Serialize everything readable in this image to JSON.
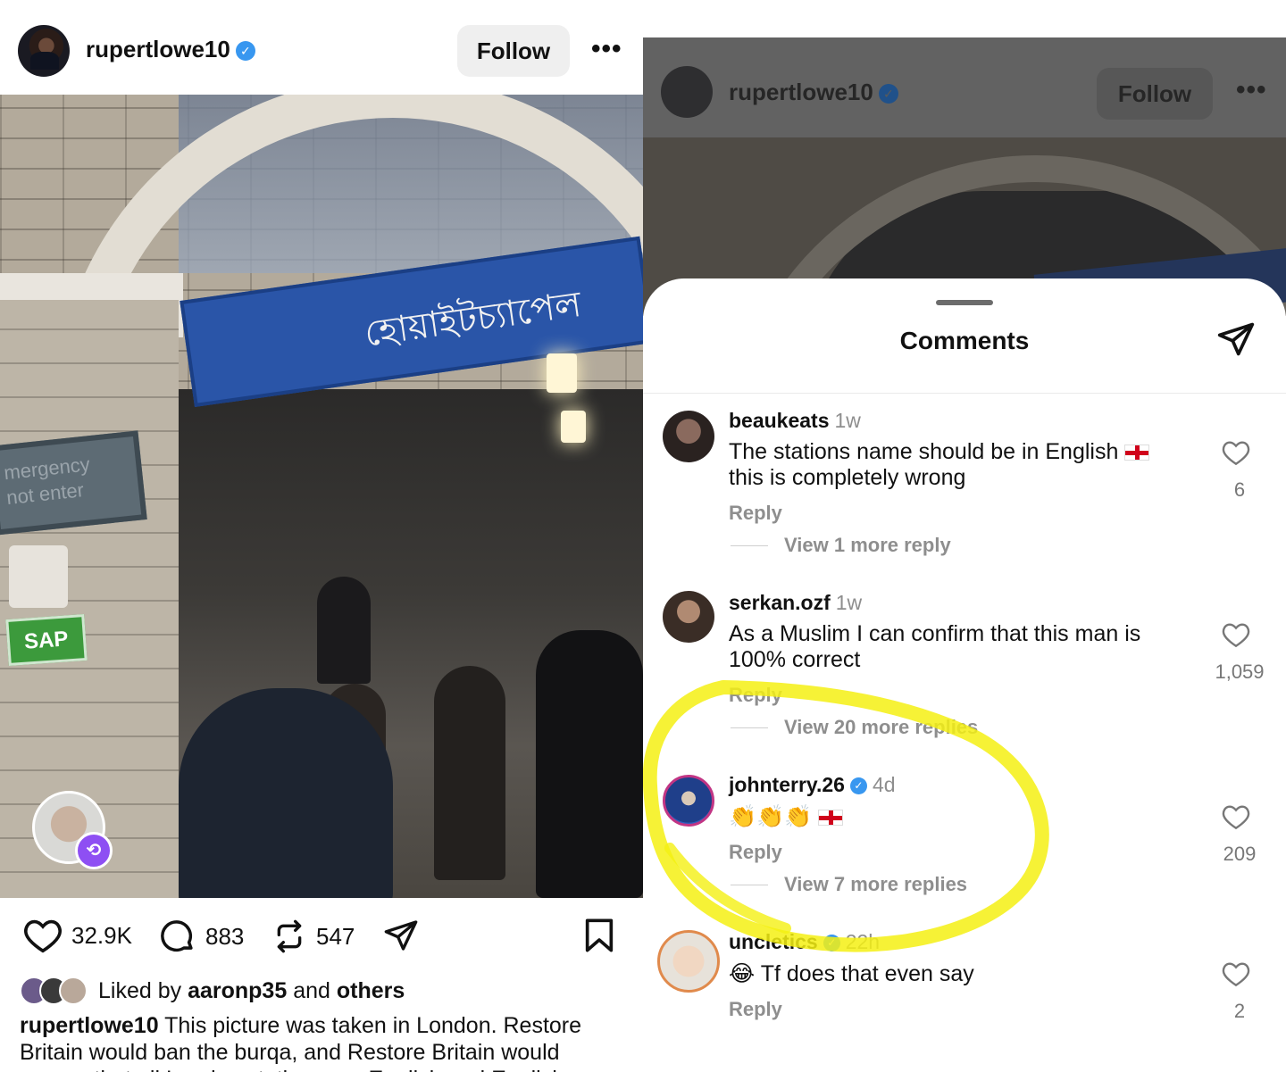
{
  "left_post": {
    "username": "rupertlowe10",
    "follow_label": "Follow",
    "more_label": "•••",
    "photo_sign_text": "হোয়াইটচ্যাপেল",
    "emergency_sign_text": "mergency\nnot enter",
    "sap_sign_text": "SAP",
    "likes_count": "32.9K",
    "comments_count": "883",
    "reposts_count": "547",
    "liked_by_prefix": "Liked by",
    "liked_by_user": "aaronp35",
    "liked_by_and": "and",
    "liked_by_others": "others",
    "caption_user": "rupertlowe10",
    "caption_text": "This picture was taken in London. Restore Britain would ban the burqa, and Restore Britain would ensure that all London stations are English and English"
  },
  "right_post": {
    "username": "rupertlowe10",
    "follow_label": "Follow",
    "more_label": "•••"
  },
  "comments_sheet": {
    "title": "Comments",
    "comments": [
      {
        "user": "beaukeats",
        "time": "1w",
        "text": "The stations name should be in English",
        "text2": "this is completely wrong",
        "reply_label": "Reply",
        "view_replies": "View 1 more reply",
        "likes": "6",
        "avatar_color": "#3a2f2c"
      },
      {
        "user": "serkan.ozf",
        "time": "1w",
        "text": "As a Muslim I can confirm that this man is",
        "text2": "100% correct",
        "reply_label": "Reply",
        "view_replies": "View 20 more replies",
        "likes": "1,059",
        "avatar_color": "#4a3b33"
      },
      {
        "user": "johnterry.26",
        "time": "4d",
        "text": "👏👏👏",
        "reply_label": "Reply",
        "view_replies": "View 7 more replies",
        "likes": "209",
        "avatar_color": "#1f3f8a"
      },
      {
        "user": "uncletics",
        "time": "22h",
        "emoji": "😂",
        "text": "Tf does that even say",
        "reply_label": "Reply",
        "likes": "2",
        "avatar_color": "#e7e2da"
      }
    ]
  },
  "colors": {
    "verified_blue": "#3897f0",
    "highlight_yellow": "#f4f013",
    "repost_purple": "#8e4ff3",
    "story_ring": "#c13584"
  }
}
